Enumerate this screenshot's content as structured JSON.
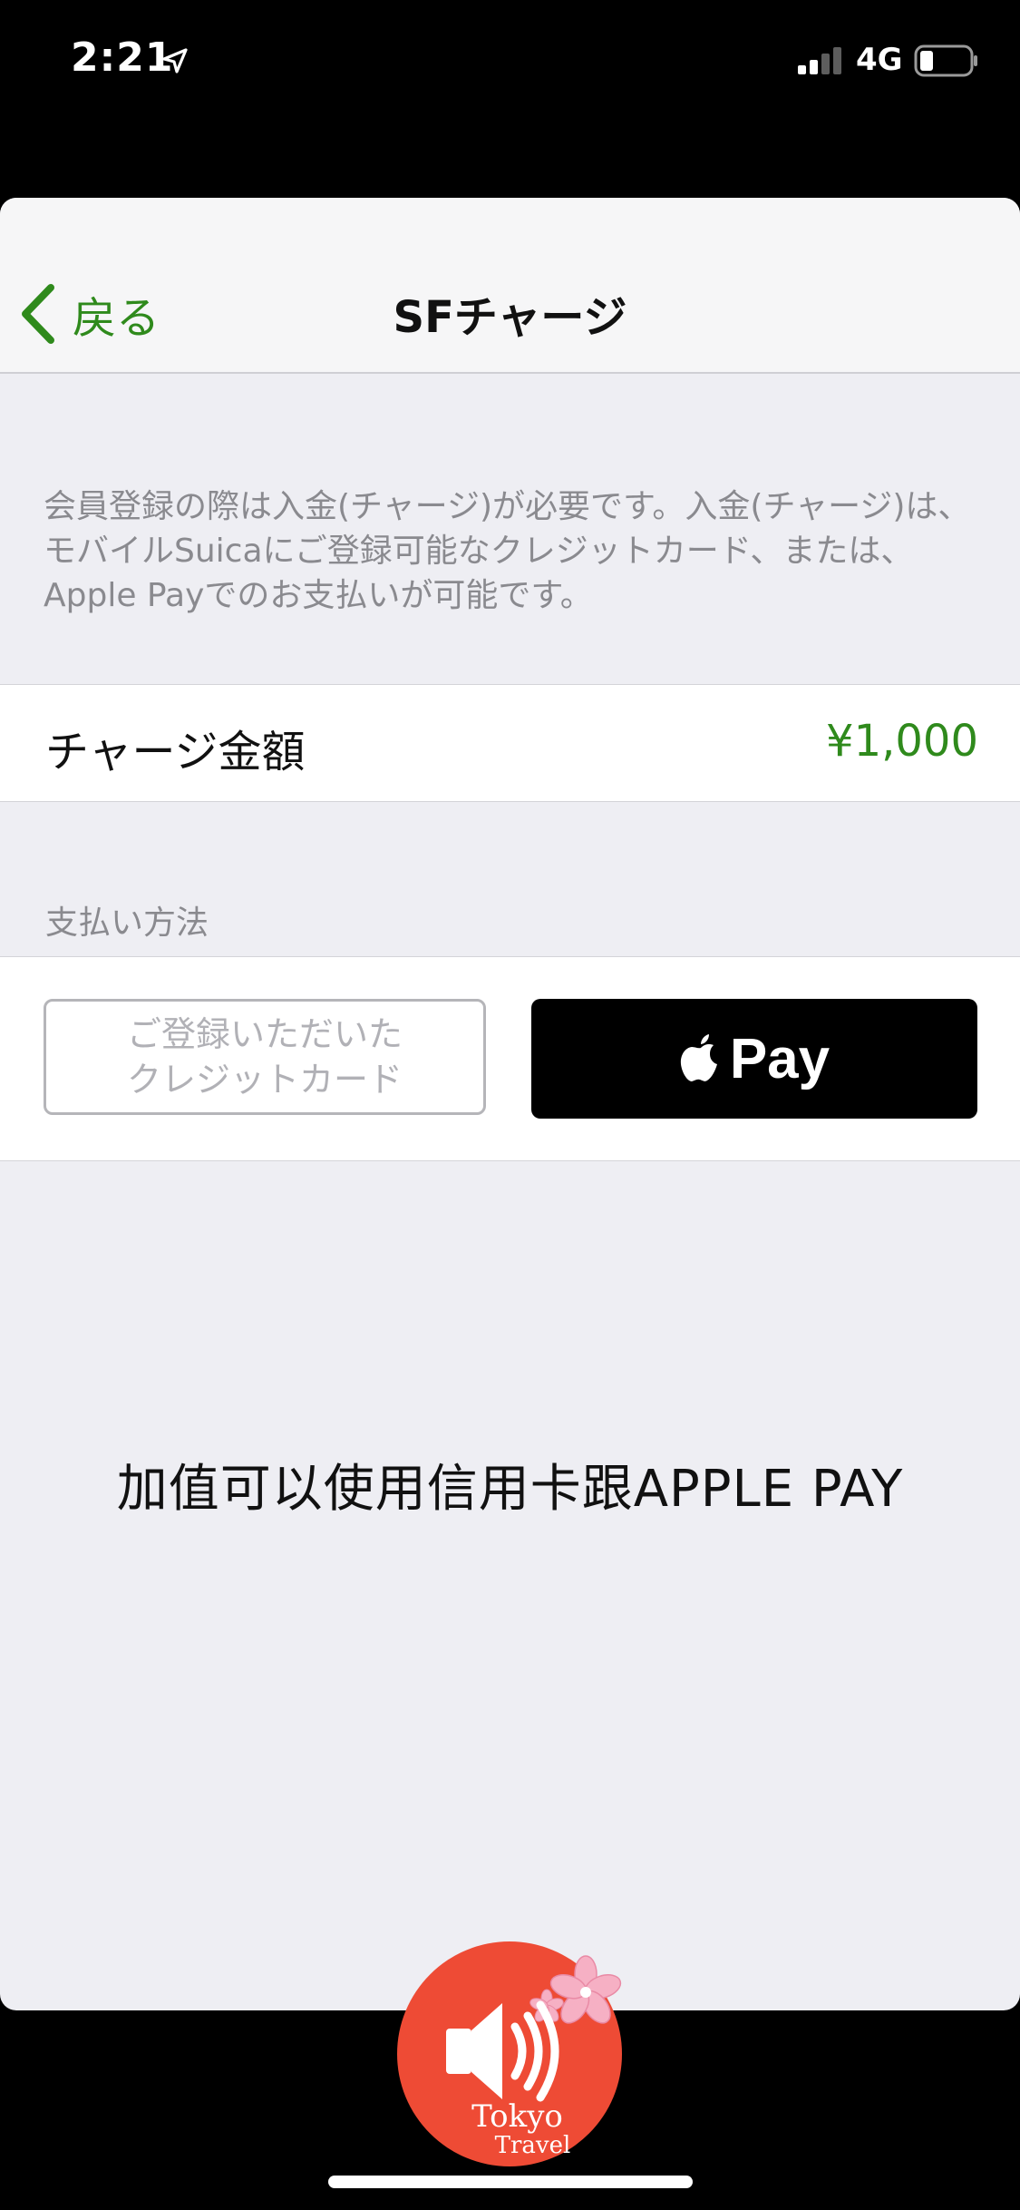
{
  "status_bar": {
    "time": "2:21",
    "network": "4G",
    "icons": [
      "location-arrow-icon",
      "signal-icon",
      "battery-icon"
    ]
  },
  "navbar": {
    "back_label": "戻る",
    "title": "SFチャージ"
  },
  "info_text": "会員登録の際は入金(チャージ)が必要です。入金(チャージ)は、モバイルSuicaにご登録可能なクレジットカード、または、Apple Payでのお支払いが可能です。",
  "charge_amount": {
    "label": "チャージ金額",
    "value": "¥1,000"
  },
  "payment": {
    "section_title": "支払い方法",
    "card_button_line1": "ご登録いただいた",
    "card_button_line2": "クレジットカード",
    "apple_pay_label": "Pay"
  },
  "caption": "加值可以使用信用卡跟APPLE PAY",
  "logo": {
    "line1": "Tokyo",
    "line2": "Travel"
  },
  "colors": {
    "accent_green": "#2f8a1c",
    "background": "#eeeef3",
    "logo_red": "#ee4b35"
  }
}
